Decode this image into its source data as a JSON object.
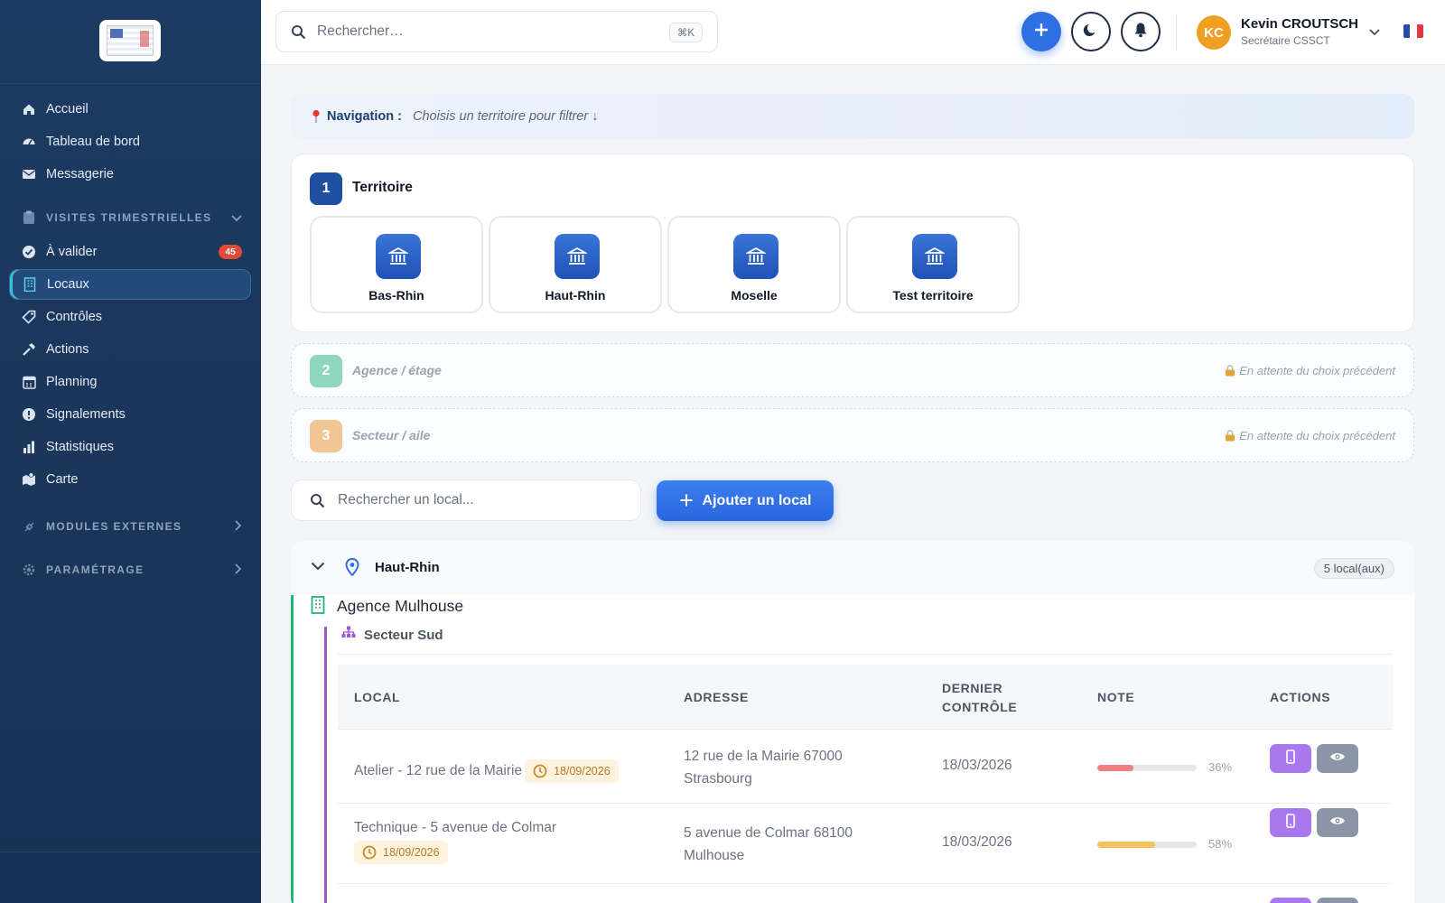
{
  "sidebar": {
    "items": [
      {
        "label": "Accueil",
        "icon": "home-icon"
      },
      {
        "label": "Tableau de bord",
        "icon": "dashboard-icon"
      },
      {
        "label": "Messagerie",
        "icon": "mail-icon"
      }
    ],
    "section_visits": "VISITES TRIMESTRIELLES",
    "visit_items": [
      {
        "label": "À valider",
        "icon": "check-circle-icon",
        "badge": "45"
      },
      {
        "label": "Locaux",
        "icon": "building-icon",
        "active": true
      },
      {
        "label": "Contrôles",
        "icon": "tag-icon"
      },
      {
        "label": "Actions",
        "icon": "hammer-icon"
      },
      {
        "label": "Planning",
        "icon": "calendar-icon"
      },
      {
        "label": "Signalements",
        "icon": "alert-icon"
      },
      {
        "label": "Statistiques",
        "icon": "bar-chart-icon"
      },
      {
        "label": "Carte",
        "icon": "map-icon"
      }
    ],
    "section_modules": "MODULES EXTERNES",
    "section_settings": "PARAMÉTRAGE"
  },
  "topbar": {
    "search_placeholder": "Rechercher…",
    "shortcut": "⌘K",
    "user_initials": "KC",
    "user_name": "Kevin CROUTSCH",
    "user_role": "Secrétaire CSSCT"
  },
  "navigation": {
    "label": "Navigation :",
    "hint": "Choisis un territoire pour filtrer ↓"
  },
  "steps": {
    "step1": {
      "num": "1",
      "title": "Territoire"
    },
    "territories": [
      "Bas-Rhin",
      "Haut-Rhin",
      "Moselle",
      "Test territoire"
    ],
    "step2": {
      "num": "2",
      "title": "Agence / étage",
      "waiting": "En attente du choix précédent"
    },
    "step3": {
      "num": "3",
      "title": "Secteur / aile",
      "waiting": "En attente du choix précédent"
    }
  },
  "locals": {
    "search_placeholder": "Rechercher un local...",
    "add_label": "Ajouter un local"
  },
  "group": {
    "territory": "Haut-Rhin",
    "count": "5 local(aux)",
    "agency": "Agence Mulhouse",
    "sector": "Secteur Sud",
    "columns": {
      "local": "LOCAL",
      "address": "ADRESSE",
      "last_control_1": "DERNIER",
      "last_control_2": "CONTRÔLE",
      "note": "NOTE",
      "actions": "ACTIONS"
    },
    "rows": [
      {
        "name": "Atelier - 12 rue de la Mairie",
        "due": "18/09/2026",
        "address_1": "12 rue de la Mairie 67000",
        "address_2": "Strasbourg",
        "last_control": "18/03/2026",
        "note": 0.36,
        "note_label": "36%",
        "note_color": "#ef7f82"
      },
      {
        "name": "Technique - 5 avenue de Colmar",
        "due": "18/09/2026",
        "address_1": "5 avenue de Colmar 68100",
        "address_2": "Mulhouse",
        "last_control": "18/03/2026",
        "note": 0.58,
        "note_label": "58%",
        "note_color": "#f5c25b"
      }
    ]
  },
  "colors": {
    "sidebar": "#1c3a63",
    "primary": "#2f6fe4",
    "accent_orange": "#f0a021",
    "green": "#22b573",
    "purple": "#9b59d0"
  }
}
